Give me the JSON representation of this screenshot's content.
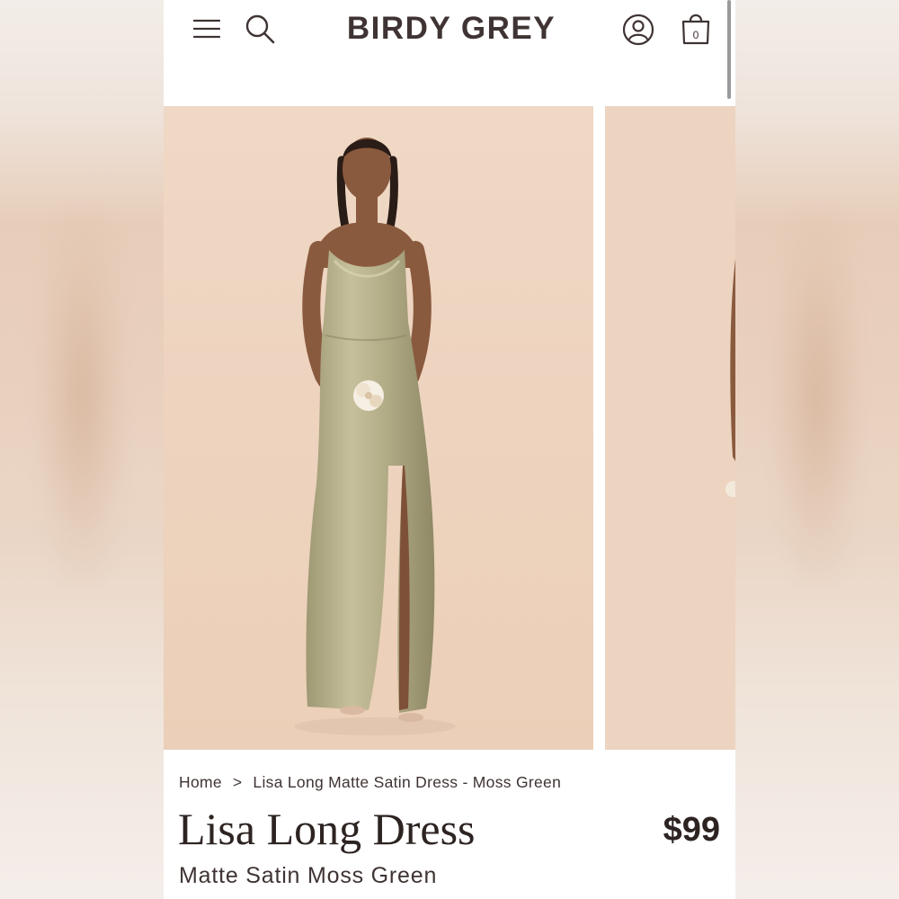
{
  "header": {
    "logo": "BIRDY GREY",
    "menu_icon": "hamburger-menu-icon",
    "search_icon": "search-icon",
    "account_icon": "account-icon",
    "cart_icon": "shopping-bag-icon",
    "cart_count": "0"
  },
  "breadcrumb": {
    "home": "Home",
    "separator": ">",
    "current": "Lisa Long Matte Satin Dress - Moss Green"
  },
  "product": {
    "title": "Lisa Long Dress",
    "price": "$99",
    "subtitle": "Matte Satin Moss Green"
  },
  "colors": {
    "text_dark": "#2d2422",
    "photo_background": "#eed6c2",
    "dress_moss_green": "#b3ad88"
  }
}
